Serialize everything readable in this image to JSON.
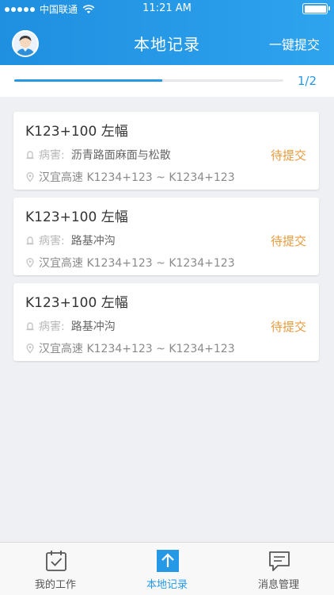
{
  "status_bar": {
    "carrier": "中国联通",
    "time": "11:21 AM"
  },
  "header": {
    "title": "本地记录",
    "submit_all": "一键提交"
  },
  "progress": {
    "text": "1/2",
    "fraction": 0.55
  },
  "records": [
    {
      "title": "K123+100 左幅",
      "disease_label": "病害:",
      "disease": "沥青路面麻面与松散",
      "status": "待提交",
      "route": "汉宜高速 K1234+123 ~ K1234+123"
    },
    {
      "title": "K123+100 左幅",
      "disease_label": "病害:",
      "disease": "路基冲沟",
      "status": "待提交",
      "route": "汉宜高速 K1234+123 ~ K1234+123"
    },
    {
      "title": "K123+100 左幅",
      "disease_label": "病害:",
      "disease": "路基冲沟",
      "status": "待提交",
      "route": "汉宜高速 K1234+123 ~ K1234+123"
    }
  ],
  "tabs": [
    {
      "label": "我的工作",
      "icon": "calendar-check-icon"
    },
    {
      "label": "本地记录",
      "icon": "upload-arrow-icon"
    },
    {
      "label": "消息管理",
      "icon": "message-icon"
    }
  ],
  "colors": {
    "accent": "#2599e6",
    "pending": "#e89a3c"
  }
}
